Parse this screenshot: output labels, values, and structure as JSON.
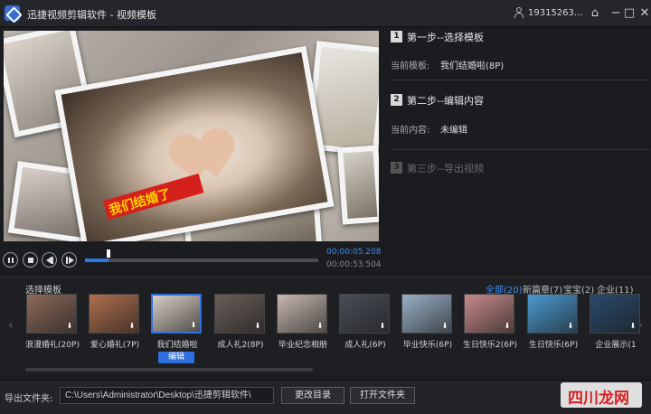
{
  "titlebar": {
    "title": "迅捷视频剪辑软件 - 视频模板",
    "user": "19315263...",
    "icons": [
      "app-logo-icon",
      "user-icon",
      "home-icon",
      "minimize-icon",
      "maximize-icon",
      "close-icon"
    ]
  },
  "preview": {
    "banner": "我们结婚了"
  },
  "player": {
    "current_time": "00:00:05.208",
    "total_time": "00:00:53.504",
    "progress": 0.1
  },
  "steps": [
    {
      "num": "1",
      "title": "第一步--选择模板",
      "label": "当前模板:",
      "value": "我们结婚啦(8P)"
    },
    {
      "num": "2",
      "title": "第二步--编辑内容",
      "label": "当前内容:",
      "value": "未编辑"
    },
    {
      "num": "3",
      "title": "第三步--导出视频"
    }
  ],
  "templates": {
    "title": "选择模板",
    "categories": [
      "全部(20)",
      "新篇章(7)",
      "宝宝(2)",
      "企业(11)"
    ],
    "items": [
      {
        "label": "浪漫婚礼(20P)",
        "color": "#8c6a5a"
      },
      {
        "label": "爱心婚礼(7P)",
        "color": "#b0704e"
      },
      {
        "label": "我们结婚啦",
        "color": "#d8cfc4"
      },
      {
        "label": "成人礼2(8P)",
        "color": "#6a5e58"
      },
      {
        "label": "毕业纪念相册",
        "color": "#c8b8b0"
      },
      {
        "label": "成人礼(6P)",
        "color": "#4a4e58"
      },
      {
        "label": "毕业快乐(6P)",
        "color": "#9ab0c8"
      },
      {
        "label": "生日快乐2(6P)",
        "color": "#c88a8a"
      },
      {
        "label": "生日快乐(6P)",
        "color": "#4a9ad0"
      },
      {
        "label": "企业展示(1",
        "color": "#2a4a6a"
      }
    ],
    "edit_label": "编辑"
  },
  "footer": {
    "label": "导出文件夹:",
    "path": "C:\\Users\\Administrator\\Desktop\\迅捷剪辑软件\\",
    "change_dir": "更改目录",
    "open_folder": "打开文件夹",
    "watermark": "四川龙网"
  },
  "colors": {
    "accent": "#2f6fe0",
    "time": "#3d8ef0",
    "banner": "#d4211c"
  }
}
